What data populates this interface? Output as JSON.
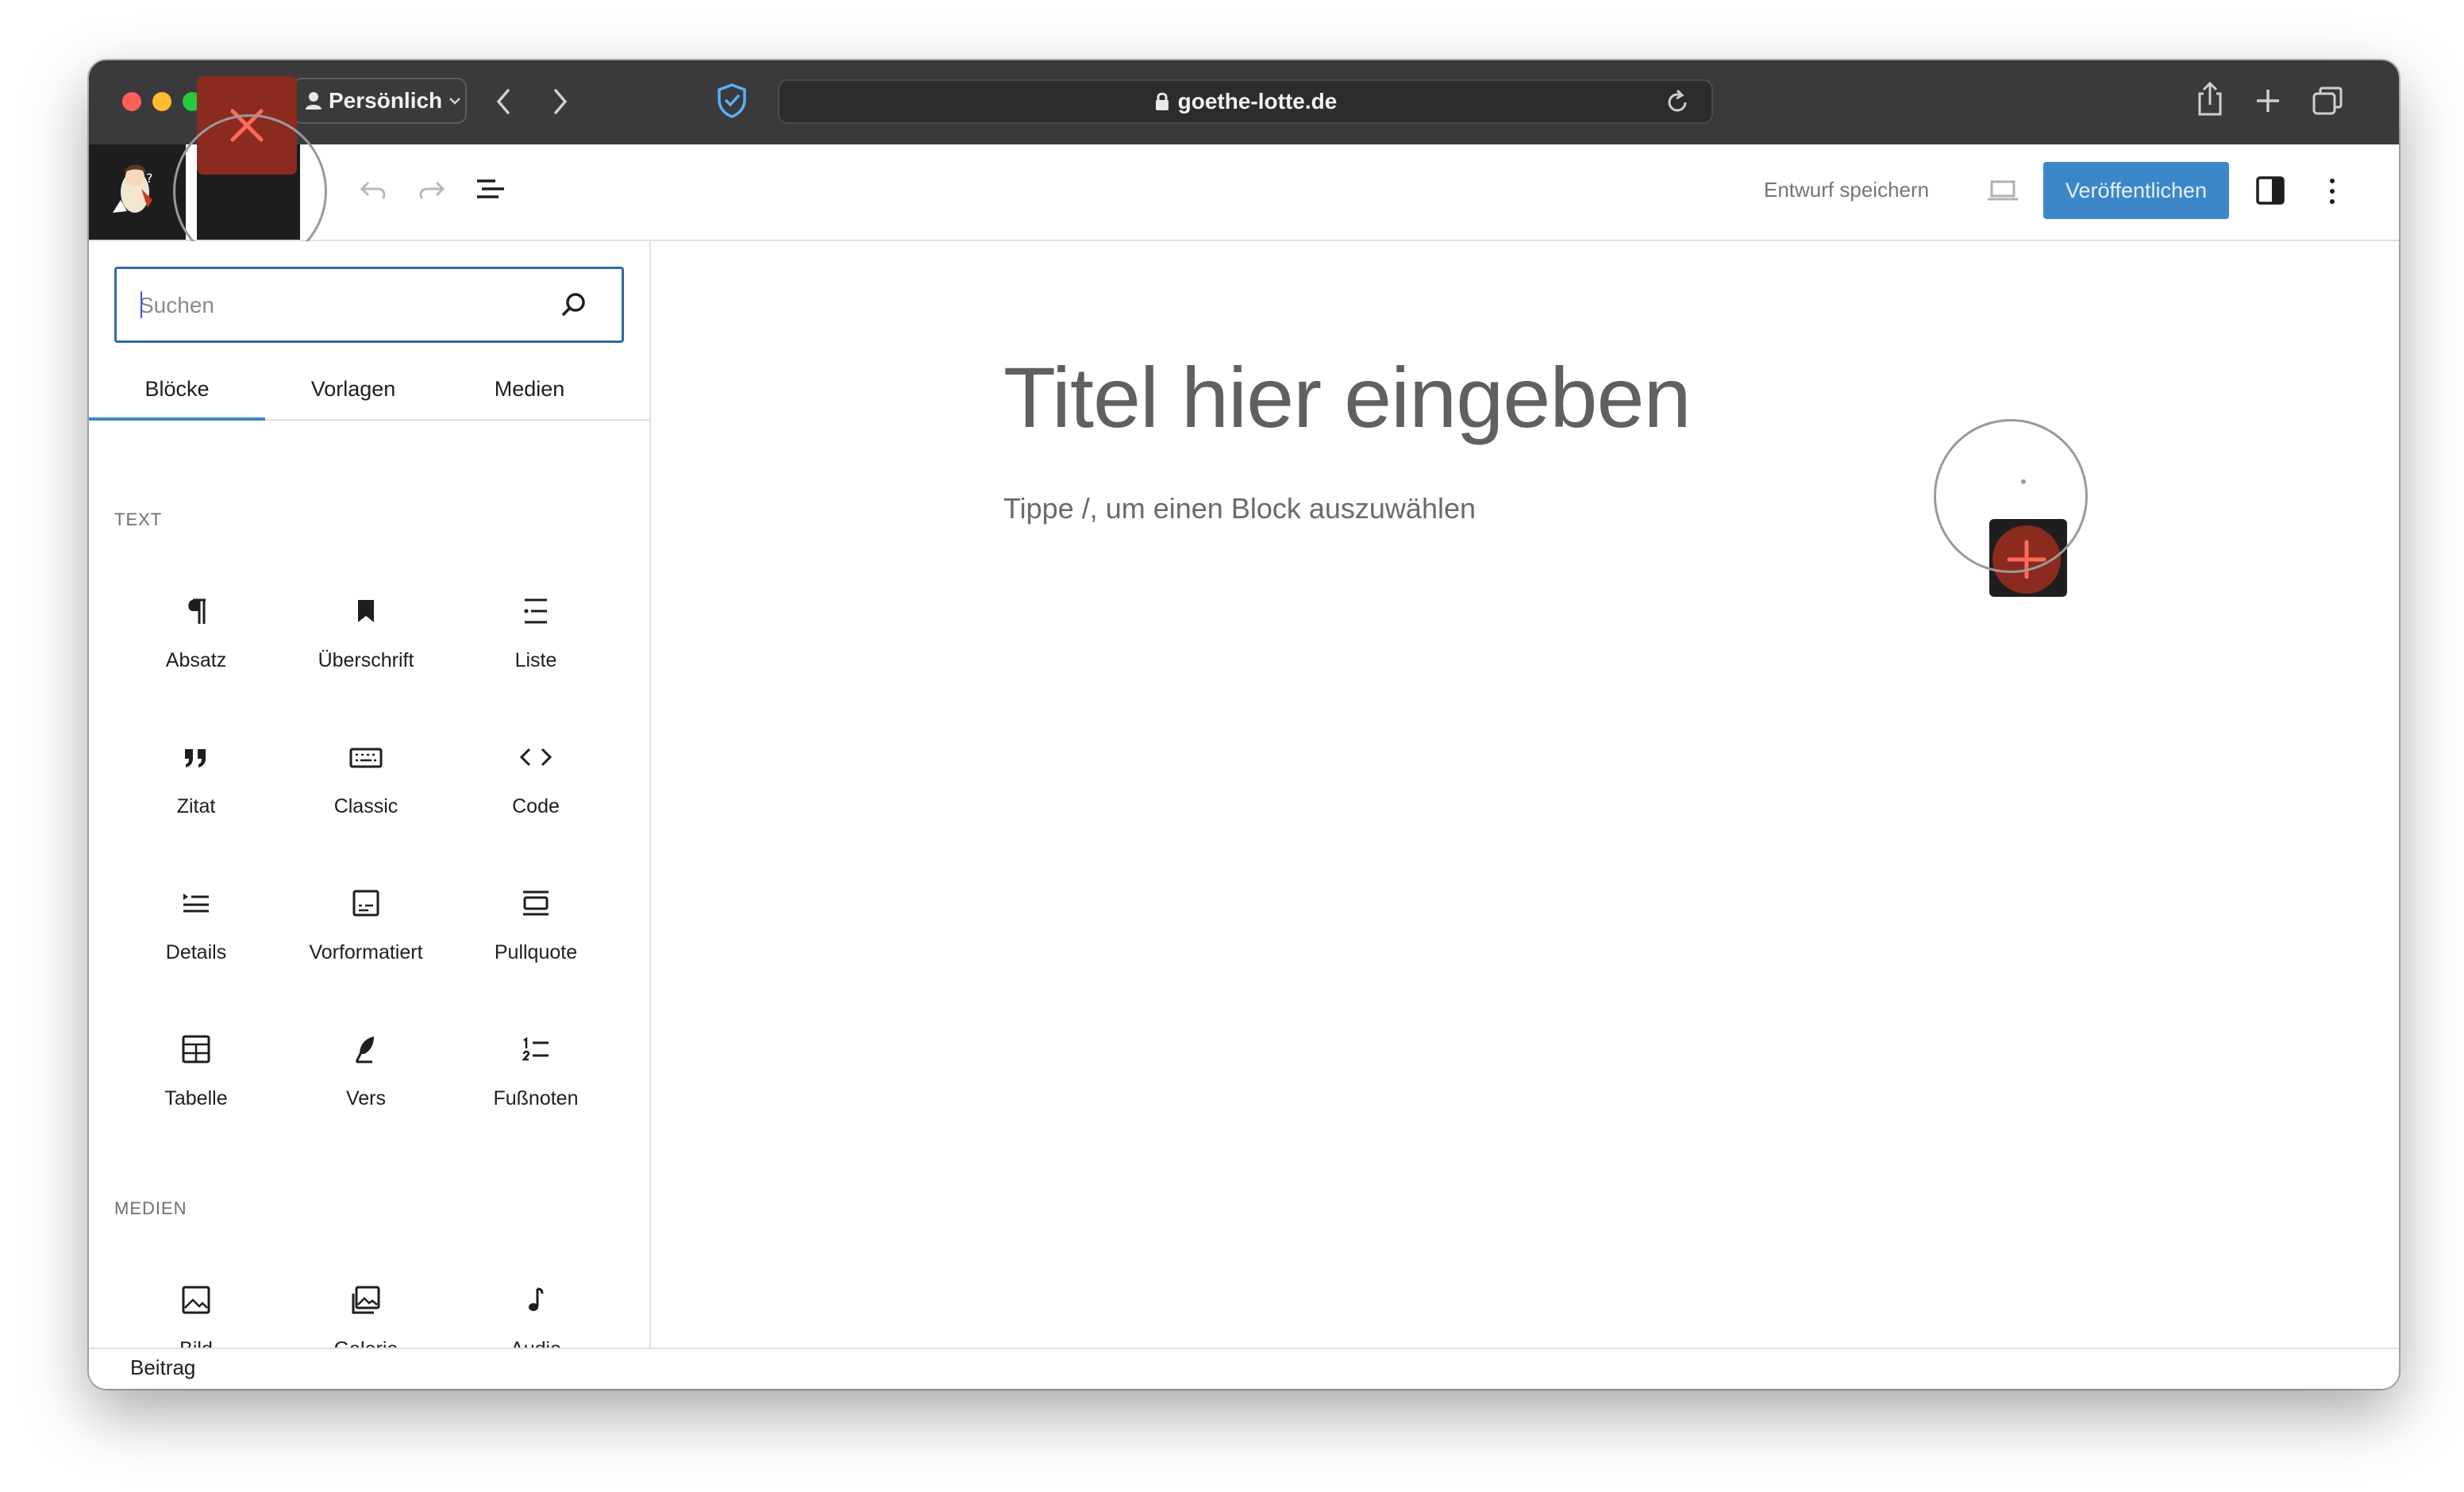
{
  "browser": {
    "profile_label": "Persönlich",
    "url": "goethe-lotte.de"
  },
  "toolbar": {
    "save_draft_label": "Entwurf speichern",
    "publish_label": "Veröffentlichen"
  },
  "inserter": {
    "search_placeholder": "Suchen",
    "tabs": [
      "Blöcke",
      "Vorlagen",
      "Medien"
    ],
    "active_tab": "Blöcke",
    "categories": [
      {
        "label": "TEXT",
        "blocks": [
          {
            "label": "Absatz",
            "icon": "paragraph-icon"
          },
          {
            "label": "Überschrift",
            "icon": "heading-icon"
          },
          {
            "label": "Liste",
            "icon": "list-icon"
          },
          {
            "label": "Zitat",
            "icon": "quote-icon"
          },
          {
            "label": "Classic",
            "icon": "keyboard-icon"
          },
          {
            "label": "Code",
            "icon": "code-icon"
          },
          {
            "label": "Details",
            "icon": "details-icon"
          },
          {
            "label": "Vorformatiert",
            "icon": "preformatted-icon"
          },
          {
            "label": "Pullquote",
            "icon": "pullquote-icon"
          },
          {
            "label": "Tabelle",
            "icon": "table-icon"
          },
          {
            "label": "Vers",
            "icon": "verse-icon"
          },
          {
            "label": "Fußnoten",
            "icon": "footnotes-icon"
          }
        ]
      },
      {
        "label": "MEDIEN",
        "blocks": [
          {
            "label": "Bild",
            "icon": "image-icon"
          },
          {
            "label": "Galerie",
            "icon": "gallery-icon"
          },
          {
            "label": "Audio",
            "icon": "audio-icon"
          }
        ]
      }
    ]
  },
  "editor": {
    "title_placeholder": "Titel hier eingeben",
    "block_hint": "Tippe /, um einen Block auszuwählen"
  },
  "footer": {
    "label": "Beitrag"
  },
  "colors": {
    "accent_blue": "#3c87c9",
    "highlight_red": "#8b2a1e",
    "chrome_dark": "#3a3a3c"
  }
}
